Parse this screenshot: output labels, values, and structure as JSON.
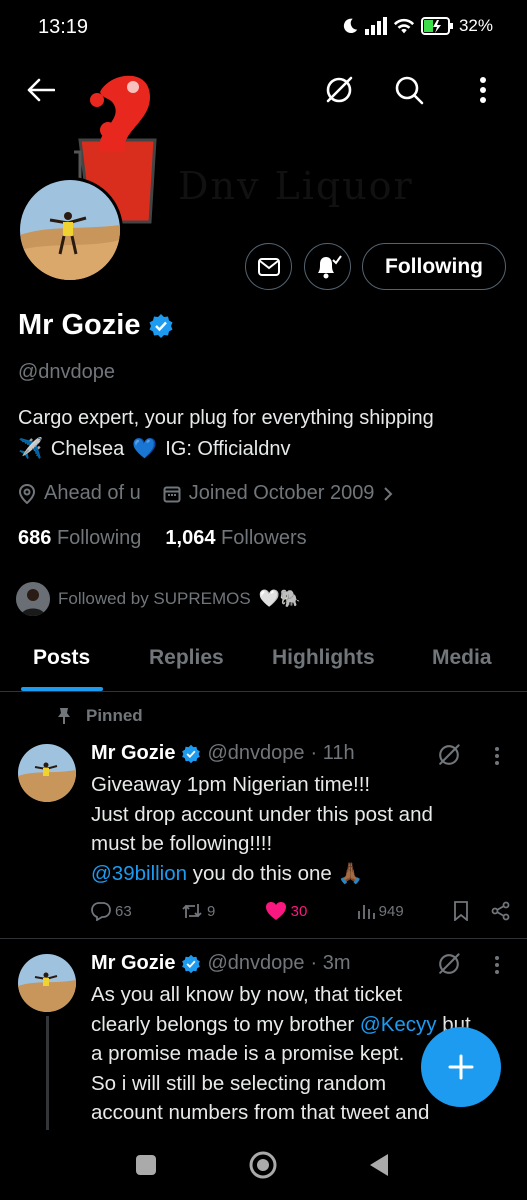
{
  "status": {
    "time": "13:19",
    "battery": "32%"
  },
  "banner": {
    "brand": "Dnv Liquor"
  },
  "profile": {
    "name": "Mr Gozie",
    "handle": "@dnvdope",
    "bio_line1": "Cargo expert, your plug for everything shipping",
    "bio_line2_plane": "✈️",
    "bio_line2_text": "Chelsea",
    "bio_line2_heart": "💙",
    "bio_line2_ig": "IG: Officialdnv",
    "location": "Ahead of u",
    "joined": "Joined October 2009",
    "following_count": "686",
    "following_label": "Following",
    "followers_count": "1,064",
    "followers_label": "Followers",
    "followed_by": "Followed by SUPREMOS",
    "followed_by_emoji": "🤍🐘"
  },
  "buttons": {
    "following": "Following"
  },
  "tabs": [
    {
      "label": "Posts"
    },
    {
      "label": "Replies"
    },
    {
      "label": "Highlights"
    },
    {
      "label": "Media"
    }
  ],
  "pinned_label": "Pinned",
  "posts": [
    {
      "name": "Mr Gozie",
      "handle": "@dnvdope",
      "time": "· 11h",
      "line1": "Giveaway 1pm Nigerian time!!!",
      "line2": "Just drop account under this post and",
      "line3": "must be following!!!!",
      "mention": "@39billion",
      "line4_rest": " you do this one 🙏🏾",
      "replies": "63",
      "reposts": "9",
      "likes": "30",
      "views": "949"
    },
    {
      "name": "Mr Gozie",
      "handle": "@dnvdope",
      "time": "· 3m",
      "line1": "As you all know by now, that  ticket",
      "line2_pre": "clearly belongs to my brother ",
      "line2_mention": "@Kecyy",
      "line2_post": " but",
      "line3": "a promise made is a promise kept.",
      "line4": "So i will still be selecting random",
      "line5": "account numbers from that tweet and"
    }
  ],
  "colors": {
    "accent": "#1d9bf0",
    "like": "#f91880",
    "muted": "#71767b",
    "banner_red": "#e8281e"
  }
}
